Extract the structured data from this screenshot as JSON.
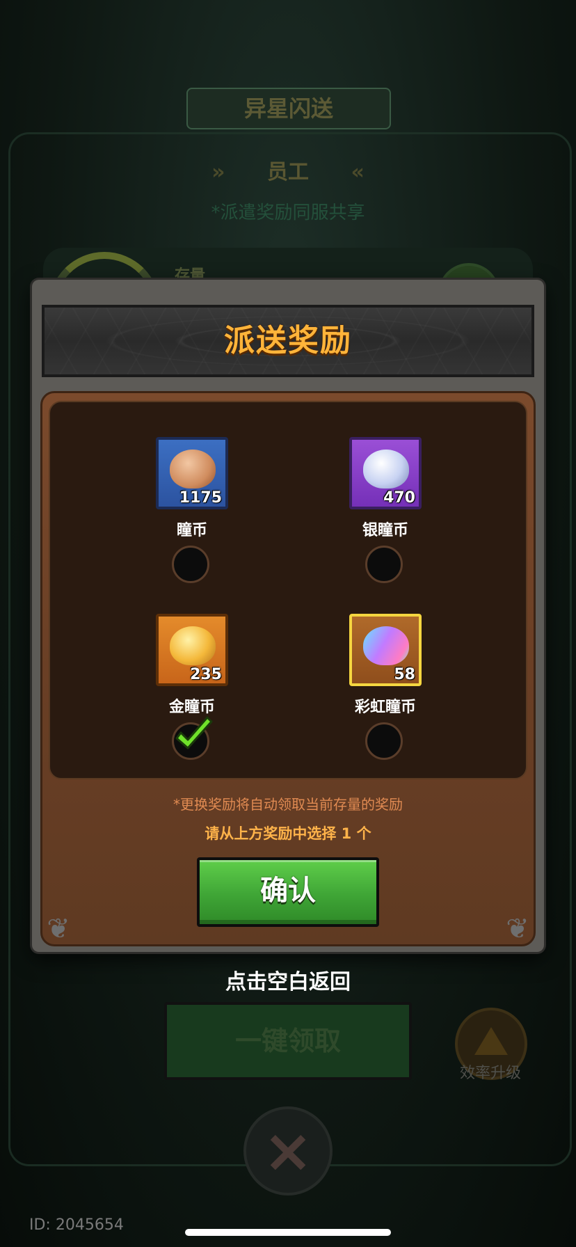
{
  "background": {
    "event_title": "异星闪送",
    "tab_title": "员工",
    "share_note": "*派遣奖励同服共享",
    "stock_label": "存量",
    "claim_all_button": "一键领取",
    "upgrade_label": "效率升级",
    "user_id": "ID: 2045654"
  },
  "modal": {
    "title": "派送奖励",
    "rewards": [
      {
        "name": "瞳币",
        "quantity": "1175",
        "icon": "bronze-coin-icon",
        "selected": false
      },
      {
        "name": "银瞳币",
        "quantity": "470",
        "icon": "silver-coin-icon",
        "selected": false
      },
      {
        "name": "金瞳币",
        "quantity": "235",
        "icon": "gold-coin-icon",
        "selected": true
      },
      {
        "name": "彩虹瞳币",
        "quantity": "58",
        "icon": "rainbow-coin-icon",
        "selected": false
      }
    ],
    "refresh_note": "*更换奖励将自动领取当前存量的奖励",
    "select_prompt": "请从上方奖励中选择 1 个",
    "confirm_button": "确认"
  },
  "tap_to_return": "点击空白返回",
  "colors": {
    "title_gold": "#ffb43a",
    "confirm_green": "#3fa536",
    "check_green": "#6fe22a",
    "note_orange": "#e08a52"
  }
}
